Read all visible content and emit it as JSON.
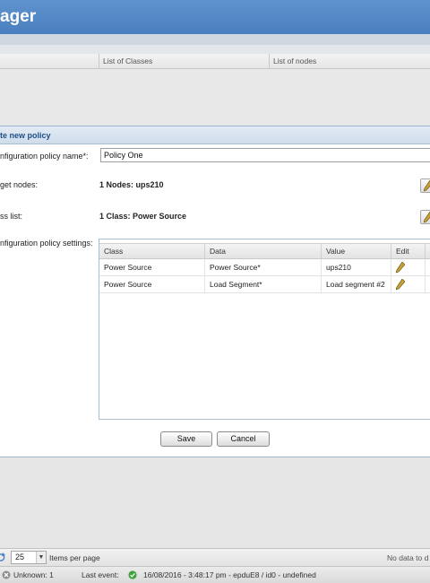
{
  "app": {
    "title": "ager"
  },
  "list_columns": [
    "List of Classes",
    "List of nodes"
  ],
  "dialog": {
    "title": "te new policy",
    "name_label": "nfiguration policy name*:",
    "name_value": "Policy One",
    "target_label": "get nodes:",
    "target_value": "1 Nodes: ups210",
    "class_label": "ss list:",
    "class_value": "1 Class: Power Source",
    "settings_label": "nfiguration policy settings:",
    "settings_table": {
      "headers": [
        "Class",
        "Data",
        "Value",
        "Edit"
      ],
      "rows": [
        {
          "class": "Power Source",
          "data": "Power Source*",
          "value": "ups210"
        },
        {
          "class": "Power Source",
          "data": "Load Segment*",
          "value": "Load segment #2"
        }
      ]
    },
    "save_label": "Save",
    "cancel_label": "Cancel"
  },
  "pager": {
    "page_size": "25",
    "items_label": "Items per page",
    "no_data": "No data to d"
  },
  "status": {
    "unknown": "Unknown: 1",
    "last_event_label": "Last event:",
    "last_event": "16/08/2016 - 3:48:17 pm - epduE8 / id0 - undefined"
  },
  "colors": {
    "header": "#4a7fbf",
    "dialog_title": "#1e4f8a",
    "ok": "#3ea33a",
    "pencil": "#c9a236"
  },
  "icons": [
    "pencil-icon",
    "refresh-icon",
    "dropdown-caret-icon",
    "unknown-status-icon",
    "check-circle-icon"
  ]
}
